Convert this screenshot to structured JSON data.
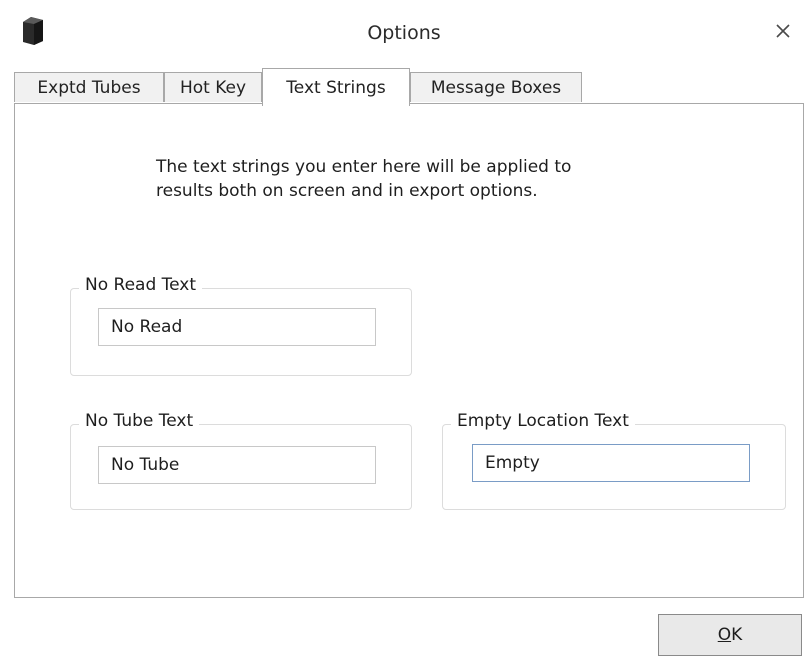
{
  "window": {
    "title": "Options",
    "close_glyph": "✕"
  },
  "tabs": [
    {
      "label": "Exptd Tubes",
      "active": false
    },
    {
      "label": "Hot Key",
      "active": false
    },
    {
      "label": "Text Strings",
      "active": true
    },
    {
      "label": "Message Boxes",
      "active": false
    }
  ],
  "panel": {
    "intro_line1": "The text strings you enter here will be applied to",
    "intro_line2": "results both on screen and in export options.",
    "no_read": {
      "label": "No Read Text",
      "value": "No Read"
    },
    "no_tube": {
      "label": "No Tube Text",
      "value": "No Tube"
    },
    "empty_location": {
      "label": "Empty Location Text",
      "value": "Empty"
    }
  },
  "buttons": {
    "ok_mnemonic": "O",
    "ok_rest": "K"
  },
  "icons": {
    "app": "app-icon",
    "close": "close-icon"
  },
  "colors": {
    "tab_inactive": "#f1f1f1",
    "border": "#a8a8a8",
    "focus_border": "#7a9cc6",
    "button_face": "#e9e9e9"
  }
}
